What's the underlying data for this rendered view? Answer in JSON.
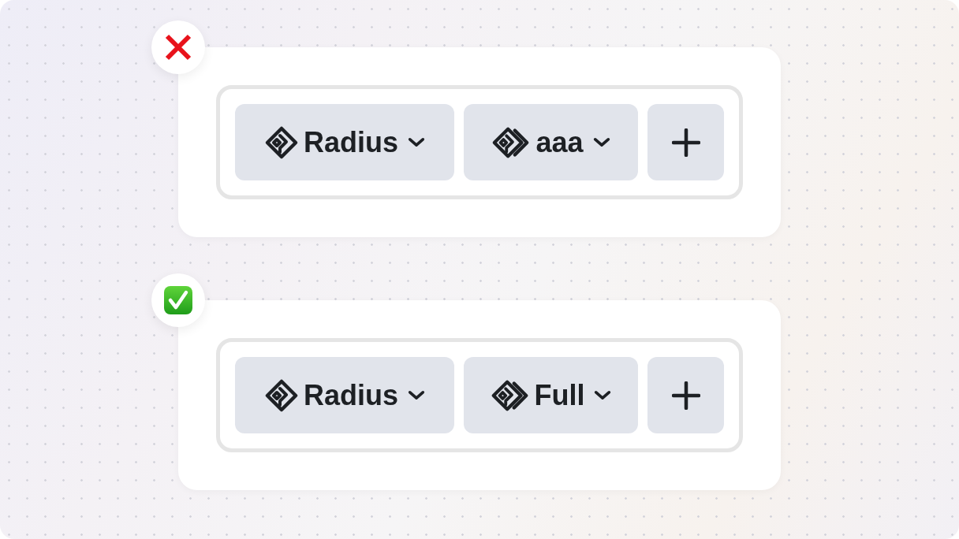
{
  "examples": [
    {
      "kind": "incorrect",
      "toolbar": {
        "dropdowns": [
          {
            "kind": "property",
            "label": "Radius"
          },
          {
            "kind": "value",
            "label": "aaa"
          }
        ]
      }
    },
    {
      "kind": "correct",
      "toolbar": {
        "dropdowns": [
          {
            "kind": "property",
            "label": "Radius"
          },
          {
            "kind": "value",
            "label": "Full"
          }
        ]
      }
    }
  ]
}
